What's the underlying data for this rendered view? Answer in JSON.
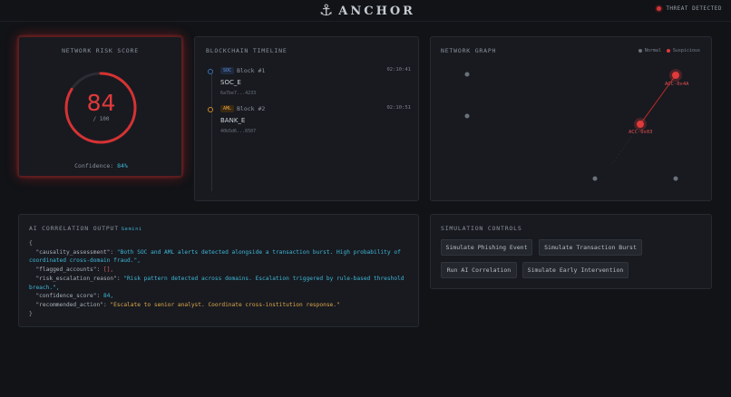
{
  "header": {
    "brand_icon": "⚓",
    "brand": "ANCHOR",
    "threat_label": "THREAT DETECTED",
    "threat_color": "#d43333"
  },
  "risk": {
    "title": "NETWORK RISK SCORE",
    "score": "84",
    "score_fraction": 0.84,
    "max": "/ 100",
    "confidence_label": "Confidence:",
    "confidence_value": "84%",
    "color": "#e03a3a"
  },
  "chain": {
    "title": "BLOCKCHAIN TIMELINE",
    "blocks": [
      {
        "badge": "SOC",
        "number": "Block #1",
        "time": "02:10:41",
        "org": "SOC_E",
        "hash": "6a7be7...4233",
        "color": "#3b6fb5"
      },
      {
        "badge": "AML",
        "number": "Block #2",
        "time": "02:10:51",
        "org": "BANK_E",
        "hash": "40b5d6...6507",
        "color": "#d08a2a"
      }
    ]
  },
  "graph": {
    "title": "NETWORK GRAPH",
    "legend_normal": "Normal",
    "legend_suspicious": "Suspicious",
    "normal_color": "#6b717a",
    "suspicious_color": "#e03a3a",
    "labels": {
      "acc_a": "ACC-0x4A",
      "acc_b": "ACC-0x03"
    }
  },
  "ai": {
    "title": "AI CORRELATION OUTPUT",
    "badge": "Gemini",
    "open_brace": "{",
    "close_brace": "}",
    "k_causality": "\"causality_assessment\":",
    "v_causality": "\"Both SOC and AML alerts detected alongside a transaction burst. High probability of coordinated cross-domain fraud.\",",
    "k_flagged": "\"flagged_accounts\":",
    "v_flagged": "[],",
    "k_reason": "\"risk_escalation_reason\":",
    "v_reason": "\"Risk pattern detected across domains. Escalation triggered by rule-based threshold breach.\",",
    "k_conf": "\"confidence_score\":",
    "v_conf": "84,",
    "k_action": "\"recommended_action\":",
    "v_action": "\"Escalate to senior analyst. Coordinate cross-institution response.\""
  },
  "sim": {
    "title": "SIMULATION CONTROLS",
    "buttons": [
      "Simulate Phishing Event",
      "Simulate Transaction Burst",
      "Run AI Correlation",
      "Simulate Early Intervention"
    ]
  }
}
